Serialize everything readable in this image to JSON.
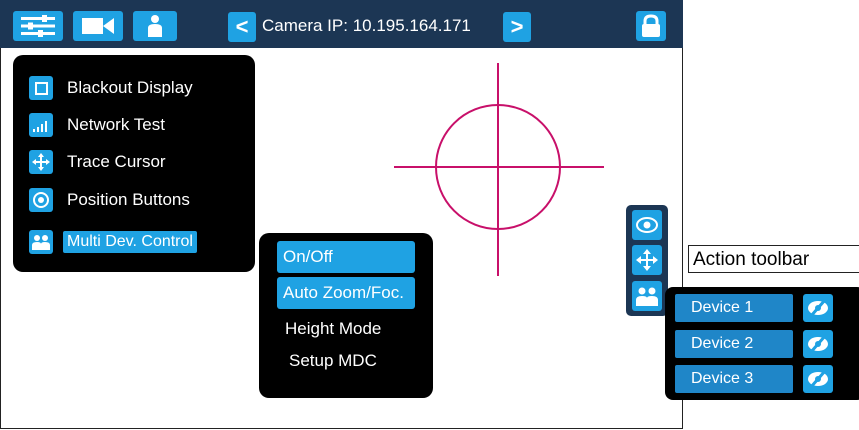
{
  "topbar": {
    "camera_ip_label": "Camera IP: 10.195.164.171",
    "prev_icon": "chevron-left-icon",
    "next_icon": "chevron-right-icon",
    "prev_glyph": "<",
    "next_glyph": ">",
    "buttons": [
      "sliders-icon",
      "video-camera-icon",
      "person-icon"
    ],
    "lock_icon": "lock-icon"
  },
  "main_menu": {
    "items": [
      {
        "label": "Blackout Display",
        "icon": "square-icon"
      },
      {
        "label": "Network Test",
        "icon": "signal-bars-icon"
      },
      {
        "label": "Trace Cursor",
        "icon": "move-arrows-icon"
      },
      {
        "label": "Position Buttons",
        "icon": "target-icon"
      },
      {
        "label": "Multi Dev. Control",
        "icon": "group-icon",
        "selected": true
      }
    ]
  },
  "submenu": {
    "items": [
      {
        "label": "On/Off",
        "selected": true
      },
      {
        "label": "Auto Zoom/Foc.",
        "selected": true
      },
      {
        "label": "Height Mode",
        "selected": false
      },
      {
        "label": "Setup MDC",
        "selected": false
      }
    ]
  },
  "action_toolbar": {
    "label": "Action toolbar",
    "buttons": [
      "eye-icon",
      "move-arrows-icon",
      "group-icon"
    ]
  },
  "devices": {
    "items": [
      {
        "label": "Device 1",
        "active": true
      },
      {
        "label": "Device 2",
        "active": false
      },
      {
        "label": "Device 3",
        "active": false
      }
    ],
    "toggle_icon": "eye-slash-icon"
  },
  "colors": {
    "topbar_bg": "#1c3654",
    "accent": "#1fa2e3",
    "crosshair": "#c8106a",
    "panel_bg": "#000000"
  }
}
